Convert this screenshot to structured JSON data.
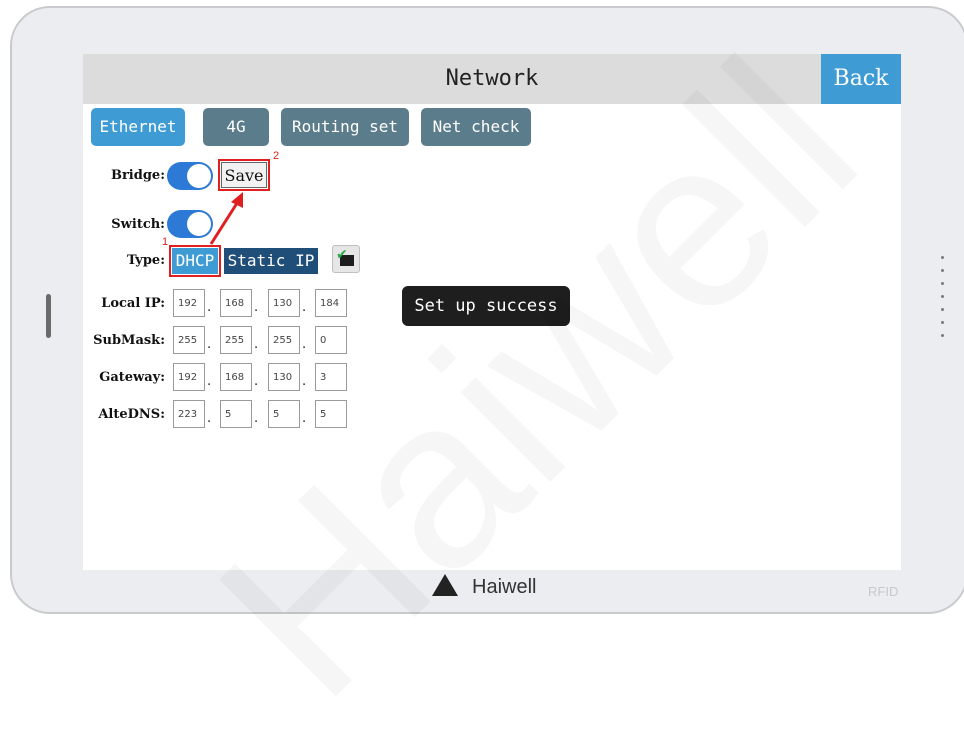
{
  "header": {
    "title": "Network",
    "back_label": "Back"
  },
  "tabs": [
    {
      "label": "Ethernet",
      "active": true
    },
    {
      "label": "4G",
      "active": false
    },
    {
      "label": "Routing set",
      "active": false
    },
    {
      "label": "Net check",
      "active": false
    }
  ],
  "bridge": {
    "label": "Bridge:",
    "enabled": true
  },
  "save_label": "Save",
  "switch": {
    "label": "Switch:",
    "enabled": true
  },
  "type": {
    "label": "Type:",
    "options": [
      "DHCP",
      "Static IP"
    ],
    "selected": "DHCP"
  },
  "annotations": {
    "step1": "1",
    "step2": "2",
    "color": "#e02020"
  },
  "fields": [
    {
      "label": "Local IP:",
      "octets": [
        "192",
        "168",
        "130",
        "184"
      ]
    },
    {
      "label": "SubMask:",
      "octets": [
        "255",
        "255",
        "255",
        "0"
      ]
    },
    {
      "label": "Gateway:",
      "octets": [
        "192",
        "168",
        "130",
        "3"
      ]
    },
    {
      "label": "AlteDNS:",
      "octets": [
        "223",
        "5",
        "5",
        "5"
      ]
    }
  ],
  "octet_separator": ".",
  "toast": "Set up success",
  "branding": {
    "name": "Haiwell",
    "rfid": "RFID",
    "watermark": "Haiwell"
  },
  "icons": {
    "network_apply": "network-check-icon"
  },
  "colors": {
    "accent": "#3f9bd4",
    "tab_inactive": "#5b7c8a",
    "toggle": "#2c7ad6"
  }
}
